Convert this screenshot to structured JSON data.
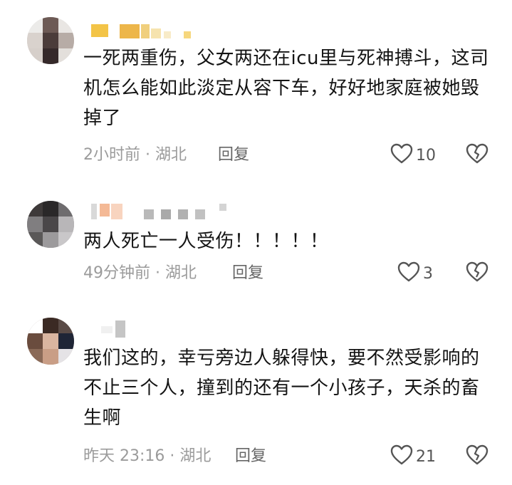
{
  "comments": [
    {
      "text": "一死两重伤，父女两还在icu里与死神搏斗，这司机怎么能如此淡定从容下车，好好地家庭被她毁掉了",
      "time_location": "2小时前 · 湖北",
      "reply_label": "回复",
      "likes": "10"
    },
    {
      "text": "两人死亡一人受伤！！！！！",
      "time_location": "49分钟前 · 湖北",
      "reply_label": "回复",
      "likes": "3"
    },
    {
      "text": "我们这的，幸亏旁边人躲得快，要不然受影响的不止三个人，撞到的还有一个小孩子，天杀的畜生啊",
      "time_location": "昨天 23:16 · 湖北",
      "reply_label": "回复",
      "likes": "21"
    }
  ],
  "icons": {
    "like": "heart-outline-icon",
    "dislike": "broken-heart-icon"
  },
  "colors": {
    "text": "#141414",
    "meta": "#9b9b9b",
    "reply": "#666666"
  }
}
